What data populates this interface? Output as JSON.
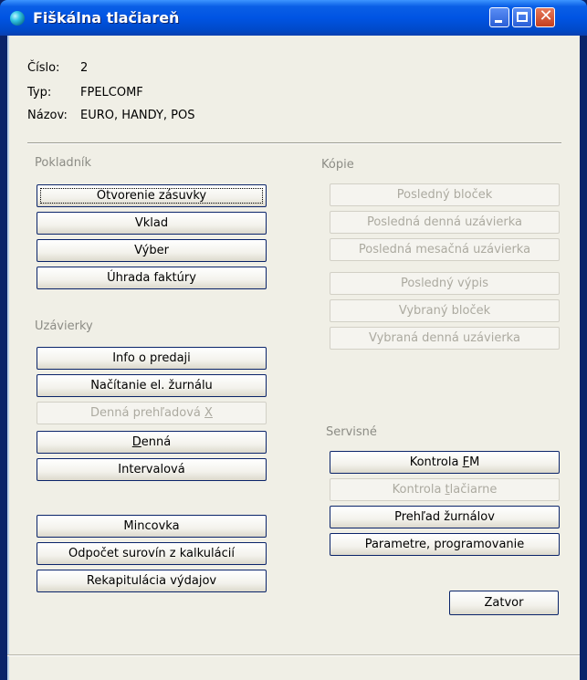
{
  "window": {
    "title": "Fiškálna tlačiareň",
    "icon": "app-globe-icon",
    "colors": {
      "titlebar": "#0054e3",
      "client": "#f0efe6",
      "button_border": "#0a246a",
      "disabled_text": "#acaaa0"
    }
  },
  "info": {
    "cislo_label": "Číslo:",
    "cislo_value": "2",
    "typ_label": "Typ:",
    "typ_value": "FPELCOMF",
    "nazov_label": "Názov:",
    "nazov_value": "EURO, HANDY, POS"
  },
  "pokladnik": {
    "heading": "Pokladník",
    "otvorenie": "Otvorenie zásuvky",
    "vklad": "Vklad",
    "vyber": "Výber",
    "uhrada": "Úhrada faktúry"
  },
  "uzavierky": {
    "heading": "Uzávierky",
    "info_predaji": "Info o predaji",
    "nacitanie": "Načítanie el. žurnálu",
    "denna_prehladova_prefix": "Denná prehľadová ",
    "denna_prehladova_key": "X",
    "denna_key": "D",
    "denna_rest": "enná",
    "intervalova": "Intervalová"
  },
  "other": {
    "mincovka": "Mincovka",
    "odpocet": "Odpočet surovín z kalkulácií",
    "rekapitulacia": "Rekapitulácia výdajov"
  },
  "kopie": {
    "heading": "Kópie",
    "posledny_blocek": "Posledný bloček",
    "posledna_denna": "Posledná denná uzávierka",
    "posledna_mesacna": "Posledná mesačná uzávierka",
    "posledny_vypis": "Posledný výpis",
    "vybrany_blocek": "Vybraný bloček",
    "vybrana_denna": "Vybraná denná uzávierka"
  },
  "servisne": {
    "heading": "Servisné",
    "kontrola_fm_prefix": "Kontrola ",
    "kontrola_fm_key": "F",
    "kontrola_fm_rest": "M",
    "kontrola_tlac_prefix": "Kontrola ",
    "kontrola_tlac_key": "t",
    "kontrola_tlac_rest": "lačiarne",
    "prehlad": "Prehľad žurnálov",
    "parametre": "Parametre, programovanie"
  },
  "footer": {
    "zatvor": "Zatvor"
  }
}
